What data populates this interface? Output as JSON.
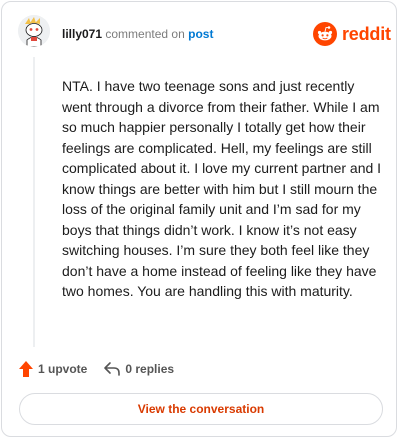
{
  "header": {
    "username": "lilly071",
    "commented_on": "commented on",
    "post_link": "post",
    "avatar_icon": "snoo-avatar-icon"
  },
  "brand": {
    "wordmark": "reddit",
    "icon": "reddit-alien-icon",
    "color": "#ff4500"
  },
  "comment": {
    "body": "NTA. I have two teenage sons and just recently went through a divorce from their father. While I am so much happier personally I totally get how their feelings are complicated. Hell, my feelings are still complicated about it. I love my current partner and I know things are better with him but I still mourn the loss of the original family unit and I’m sad for my boys that things didn’t work. I know it’s not easy switching houses. I’m sure they both feel like they don’t have a home instead of feeling like they have two homes. You are handling this with maturity."
  },
  "actions": {
    "upvotes_label": "1 upvote",
    "upvote_icon": "upvote-arrow-icon",
    "replies_label": "0 replies",
    "reply_icon": "reply-arrow-icon"
  },
  "footer": {
    "view_label": "View the conversation",
    "accent": "#d93a00"
  }
}
